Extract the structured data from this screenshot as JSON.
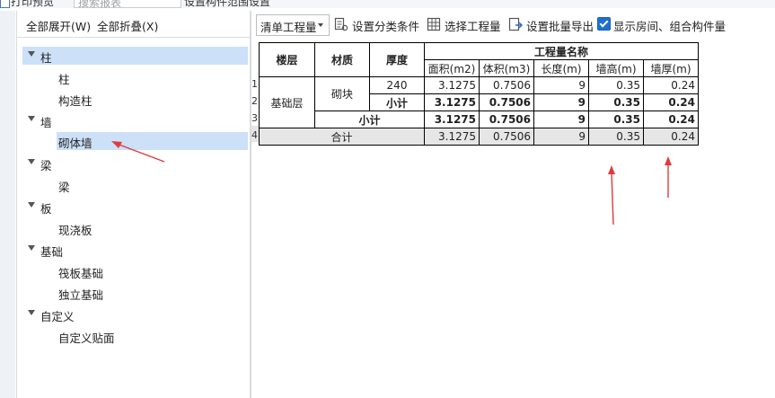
{
  "top": {
    "title_partial": "打印预览",
    "search_placeholder": "搜索报表",
    "right_partial": "设置构件范围设置"
  },
  "left": {
    "expand_all": "全部展开(W)",
    "collapse_all": "全部折叠(X)",
    "tree": [
      {
        "label": "柱",
        "level": 0,
        "expanded": true,
        "selected": true
      },
      {
        "label": "柱",
        "level": 1
      },
      {
        "label": "构造柱",
        "level": 1
      },
      {
        "label": "墙",
        "level": 0,
        "expanded": true
      },
      {
        "label": "砌体墙",
        "level": 1,
        "selected": true
      },
      {
        "label": "梁",
        "level": 0,
        "expanded": true
      },
      {
        "label": "梁",
        "level": 1
      },
      {
        "label": "板",
        "level": 0,
        "expanded": true
      },
      {
        "label": "现浇板",
        "level": 1
      },
      {
        "label": "基础",
        "level": 0,
        "expanded": true
      },
      {
        "label": "筏板基础",
        "level": 1
      },
      {
        "label": "独立基础",
        "level": 1
      },
      {
        "label": "自定义",
        "level": 0,
        "expanded": true
      },
      {
        "label": "自定义贴面",
        "level": 1
      }
    ]
  },
  "toolbar": {
    "dropdown_value": "清单工程量",
    "set_category": "设置分类条件",
    "select_quantity": "选择工程量",
    "set_batch_export": "设置批量导出",
    "show_room_label": "显示房间、组合构件量",
    "show_room_checked": true
  },
  "table": {
    "headers": {
      "floor": "楼层",
      "material": "材质",
      "thickness": "厚度",
      "quantity_name": "工程量名称",
      "area": "面积(m2)",
      "volume": "体积(m3)",
      "length": "长度(m)",
      "wall_height": "墙高(m)",
      "wall_thickness": "墙厚(m)"
    },
    "row_indices": [
      "1",
      "2",
      "3",
      "4"
    ],
    "floor_value": "基础层",
    "material_value": "砌块",
    "row1": {
      "thickness": "240",
      "area": "3.1275",
      "volume": "0.7506",
      "length": "9",
      "wall_height": "0.35",
      "wall_thickness": "0.24"
    },
    "row2": {
      "label": "小计",
      "area": "3.1275",
      "volume": "0.7506",
      "length": "9",
      "wall_height": "0.35",
      "wall_thickness": "0.24"
    },
    "row3": {
      "label": "小计",
      "area": "3.1275",
      "volume": "0.7506",
      "length": "9",
      "wall_height": "0.35",
      "wall_thickness": "0.24"
    },
    "row4": {
      "label": "合计",
      "area": "3.1275",
      "volume": "0.7506",
      "length": "9",
      "wall_height": "0.35",
      "wall_thickness": "0.24"
    }
  },
  "colors": {
    "selection": "#cce0f8",
    "checkbox": "#1f6fd1",
    "annotation_arrow": "#e03a3a",
    "total_row_bg": "#e6e6e6"
  }
}
